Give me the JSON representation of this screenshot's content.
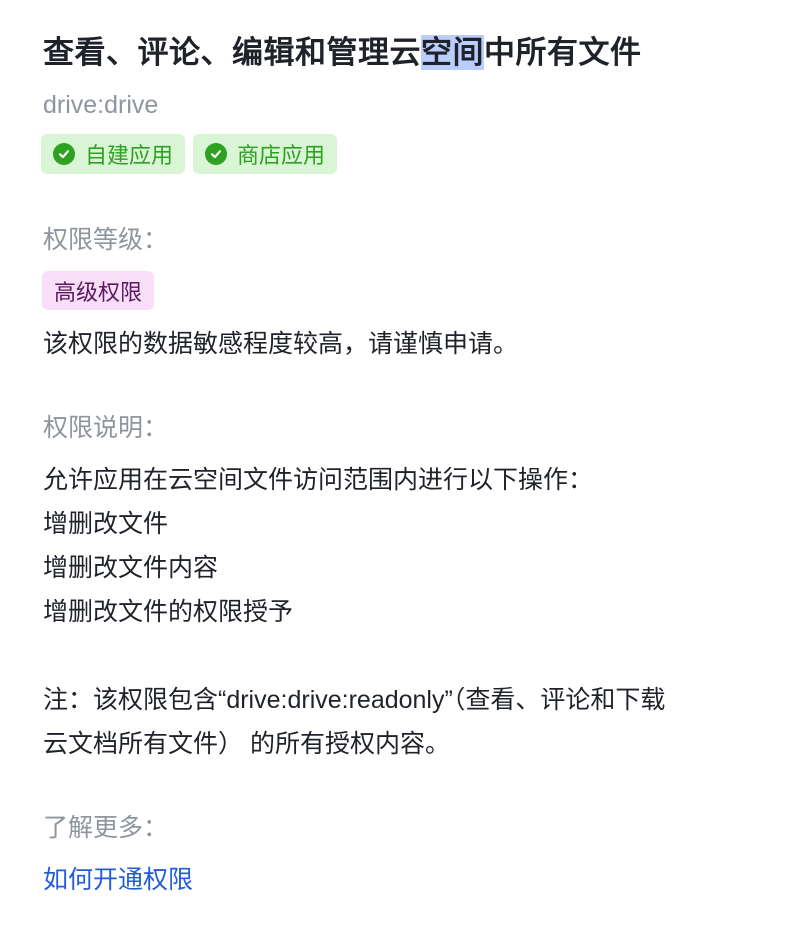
{
  "scope": {
    "title_before": "查看、评论、编辑和管理云",
    "title_highlight": "空间",
    "title_after": "中所有文件",
    "key": "drive:drive",
    "badges": [
      {
        "label": "自建应用",
        "icon": "check-circle-icon"
      },
      {
        "label": "商店应用",
        "icon": "check-circle-icon"
      }
    ]
  },
  "level": {
    "label": "权限等级：",
    "tag": "高级权限",
    "description": "该权限的数据敏感程度较高，请谨慎申请。"
  },
  "explanation": {
    "label": "权限说明：",
    "lines": [
      "允许应用在云空间文件访问范围内进行以下操作：",
      "增删改文件",
      "增删改文件内容",
      "增删改文件的权限授予"
    ],
    "note_lines": [
      "注：该权限包含“drive:drive:readonly”（查看、评论和下载",
      "云文档所有文件） 的所有授权内容。"
    ]
  },
  "learn_more": {
    "label": "了解更多：",
    "link": "如何开通权限"
  },
  "colors": {
    "badge_green": "#2ea121",
    "badge_bg": "#d9f5d6",
    "level_bg": "#f8def8",
    "link_blue": "#245bdb",
    "highlight": "#bacefd"
  }
}
